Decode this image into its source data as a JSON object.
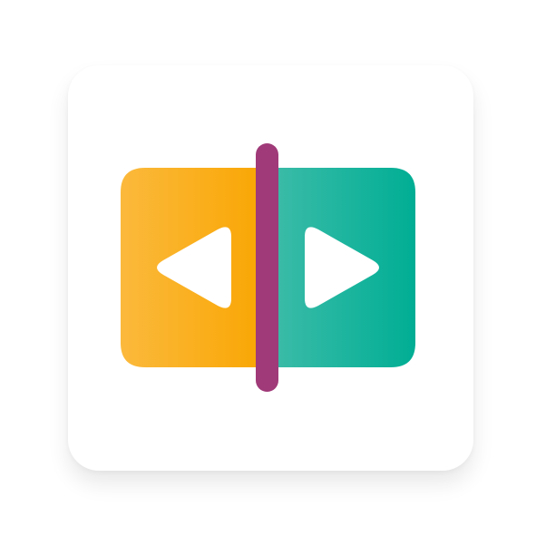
{
  "icon": {
    "name": "split-video-compare-icon",
    "colors": {
      "left_panel_start": "#FBB93C",
      "left_panel_end": "#F9A602",
      "right_panel_start": "#3EBCA9",
      "right_panel_end": "#00AE94",
      "divider": "#A03A78",
      "arrows": "#FFFFFF",
      "tile_background": "#FFFFFF"
    },
    "left_arrow_icon": "play-left-icon",
    "right_arrow_icon": "play-right-icon"
  }
}
